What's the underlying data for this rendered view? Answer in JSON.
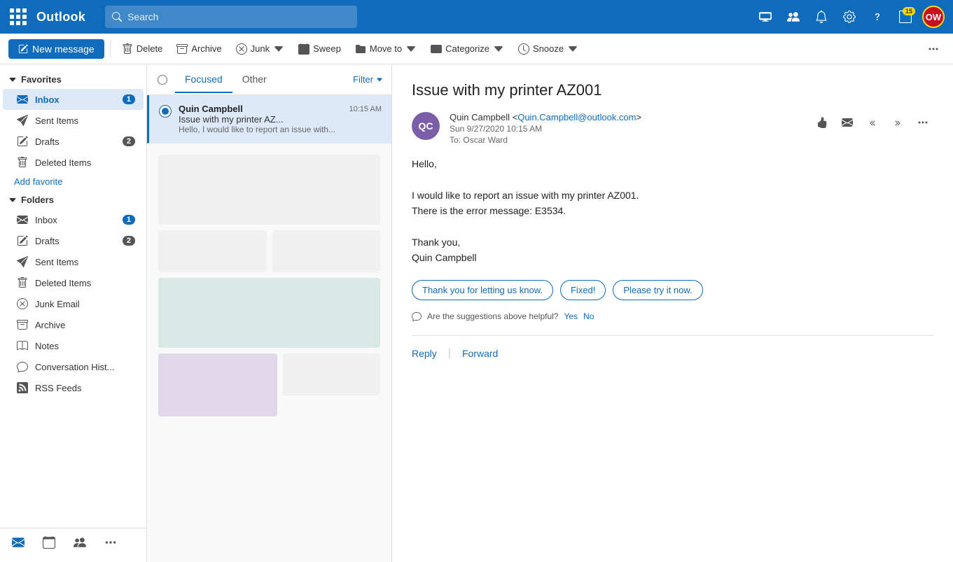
{
  "app": {
    "title": "Outlook",
    "search_placeholder": "Search"
  },
  "topbar": {
    "icons": [
      "monitor-icon",
      "people-icon",
      "bell-icon",
      "settings-icon",
      "help-icon"
    ],
    "notification_count": "15",
    "avatar_initials": "OW",
    "avatar_badge": true
  },
  "toolbar": {
    "new_message": "New message",
    "delete": "Delete",
    "archive": "Archive",
    "junk": "Junk",
    "sweep": "Sweep",
    "move_to": "Move to",
    "categorize": "Categorize",
    "snooze": "Snooze"
  },
  "sidebar": {
    "favorites_label": "Favorites",
    "folders_label": "Folders",
    "favorites_items": [
      {
        "name": "inbox-fav",
        "label": "Inbox",
        "count": 1,
        "icon": "inbox-icon"
      },
      {
        "name": "sent-fav",
        "label": "Sent Items",
        "count": null,
        "icon": "sent-icon"
      },
      {
        "name": "drafts-fav",
        "label": "Drafts",
        "count": 2,
        "icon": "drafts-icon"
      },
      {
        "name": "deleted-fav",
        "label": "Deleted Items",
        "count": null,
        "icon": "trash-icon"
      }
    ],
    "add_favorite": "Add favorite",
    "folder_items": [
      {
        "name": "inbox-folder",
        "label": "Inbox",
        "count": 1,
        "icon": "inbox-icon"
      },
      {
        "name": "drafts-folder",
        "label": "Drafts",
        "count": 2,
        "icon": "drafts-icon"
      },
      {
        "name": "sent-folder",
        "label": "Sent Items",
        "count": null,
        "icon": "sent-icon"
      },
      {
        "name": "deleted-folder",
        "label": "Deleted Items",
        "count": null,
        "icon": "trash-icon"
      },
      {
        "name": "junk-folder",
        "label": "Junk Email",
        "count": null,
        "icon": "junk-icon"
      },
      {
        "name": "archive-folder",
        "label": "Archive",
        "count": null,
        "icon": "archive-icon"
      },
      {
        "name": "notes-folder",
        "label": "Notes",
        "count": null,
        "icon": "notes-icon"
      },
      {
        "name": "convhist-folder",
        "label": "Conversation Hist...",
        "count": null,
        "icon": "chat-icon"
      },
      {
        "name": "rss-folder",
        "label": "RSS Feeds",
        "count": null,
        "icon": "rss-icon"
      }
    ],
    "bottom_icons": [
      "mail-bottom-icon",
      "calendar-bottom-icon",
      "contacts-bottom-icon",
      "more-bottom-icon"
    ]
  },
  "email_list": {
    "tabs": [
      {
        "name": "focused-tab",
        "label": "Focused",
        "active": true
      },
      {
        "name": "other-tab",
        "label": "Other",
        "active": false
      }
    ],
    "filter_label": "Filter",
    "emails": [
      {
        "sender": "Quin Campbell",
        "subject": "Issue with my printer AZ...",
        "preview": "Hello, I would like to report an issue with...",
        "time": "10:15 AM",
        "selected": true
      }
    ]
  },
  "email_detail": {
    "title": "Issue with my printer AZ001",
    "sender_name": "Quin Campbell",
    "sender_email": "Quin.Campbell@outlook.com",
    "sender_initials": "QC",
    "date": "Sun 9/27/2020 10:15 AM",
    "to_label": "To:",
    "to_name": "Oscar Ward",
    "body_lines": [
      "Hello,",
      "",
      "I would like to report an issue with my printer AZ001.",
      "There is the error message: E3534.",
      "",
      "Thank you,",
      "Quin Campbell"
    ],
    "suggestions": [
      "Thank you for letting us know.",
      "Fixed!",
      "Please try it now."
    ],
    "suggestions_prompt": "Are the suggestions above helpful?",
    "suggestions_yes": "Yes",
    "suggestions_no": "No",
    "reply_label": "Reply",
    "forward_label": "Forward"
  }
}
